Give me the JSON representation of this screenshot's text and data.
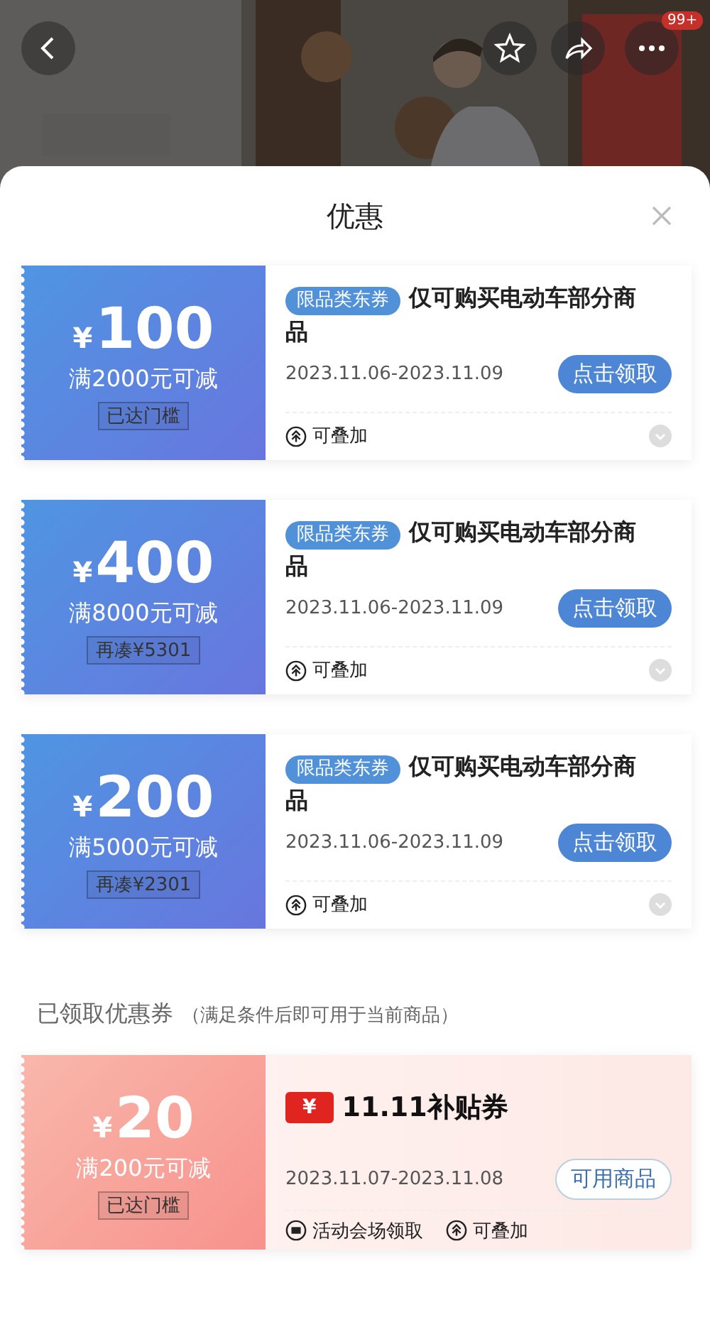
{
  "top_bar": {
    "badge": "99+"
  },
  "sheet": {
    "title": "优惠"
  },
  "coupons": [
    {
      "kind": "available",
      "currency": "¥",
      "amount": "100",
      "condition": "满2000元可减",
      "threshold": "已达门槛",
      "tag": "限品类东券",
      "title": "仅可购买电动车部分商品",
      "dates": "2023.11.06-2023.11.09",
      "button": "点击领取",
      "features": [
        {
          "kind": "stack",
          "text": "可叠加"
        }
      ]
    },
    {
      "kind": "available",
      "currency": "¥",
      "amount": "400",
      "condition": "满8000元可减",
      "threshold": "再凑¥5301",
      "tag": "限品类东券",
      "title": "仅可购买电动车部分商品",
      "dates": "2023.11.06-2023.11.09",
      "button": "点击领取",
      "features": [
        {
          "kind": "stack",
          "text": "可叠加"
        }
      ]
    },
    {
      "kind": "available",
      "currency": "¥",
      "amount": "200",
      "condition": "满5000元可减",
      "threshold": "再凑¥2301",
      "tag": "限品类东券",
      "title": "仅可购买电动车部分商品",
      "dates": "2023.11.06-2023.11.09",
      "button": "点击领取",
      "features": [
        {
          "kind": "stack",
          "text": "可叠加"
        }
      ]
    }
  ],
  "claimed_section": {
    "heading": "已领取优惠券",
    "note": "（满足条件后即可用于当前商品）"
  },
  "claimed_coupons": [
    {
      "kind": "claimed",
      "currency": "¥",
      "amount": "20",
      "condition": "满200元可减",
      "threshold": "已达门槛",
      "badge": "¥",
      "title": "11.11补贴券",
      "dates": "2023.11.07-2023.11.08",
      "button": "可用商品",
      "features": [
        {
          "kind": "venue",
          "text": "活动会场领取"
        },
        {
          "kind": "stack",
          "text": "可叠加"
        }
      ]
    }
  ]
}
